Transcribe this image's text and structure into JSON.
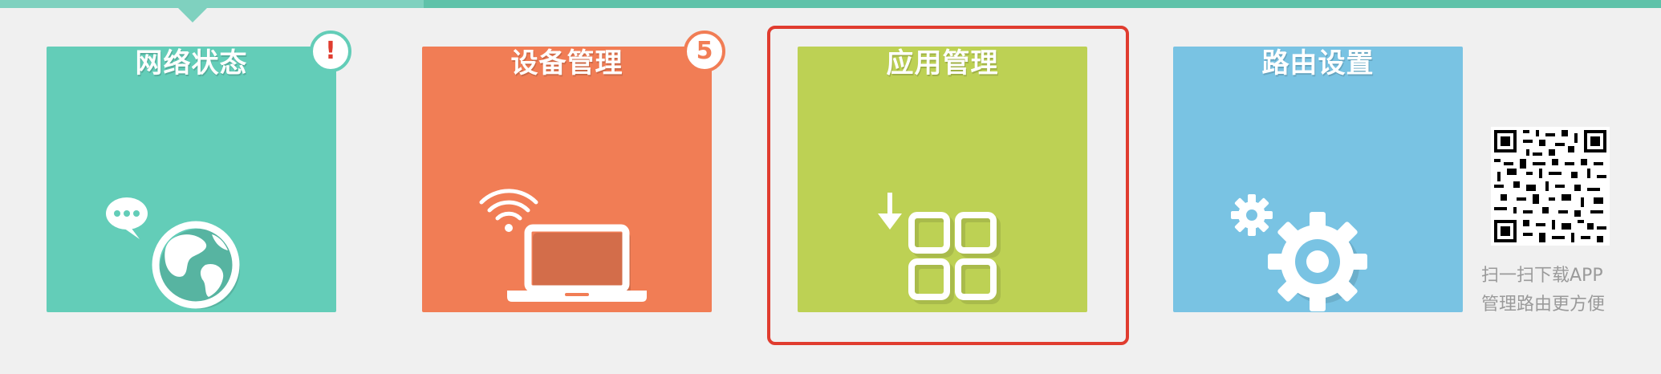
{
  "tiles": [
    {
      "title": "网络状态",
      "icon": "globe-chat-icon",
      "color": "#63cdb8"
    },
    {
      "title": "设备管理",
      "icon": "wifi-laptop-icon",
      "color": "#f17d55"
    },
    {
      "title": "应用管理",
      "icon": "app-download-grid-icon",
      "color": "#bdd154"
    },
    {
      "title": "路由设置",
      "icon": "gears-icon",
      "color": "#79c3e3"
    }
  ],
  "badges": {
    "network_alert": "!",
    "device_count": "5"
  },
  "qr": {
    "caption_line1": "扫一扫下载APP",
    "caption_line2": "管理路由更方便"
  },
  "colors": {
    "highlight": "#e03c2f",
    "top_strip": "#5fc2a9",
    "background": "#f0f0f0"
  }
}
